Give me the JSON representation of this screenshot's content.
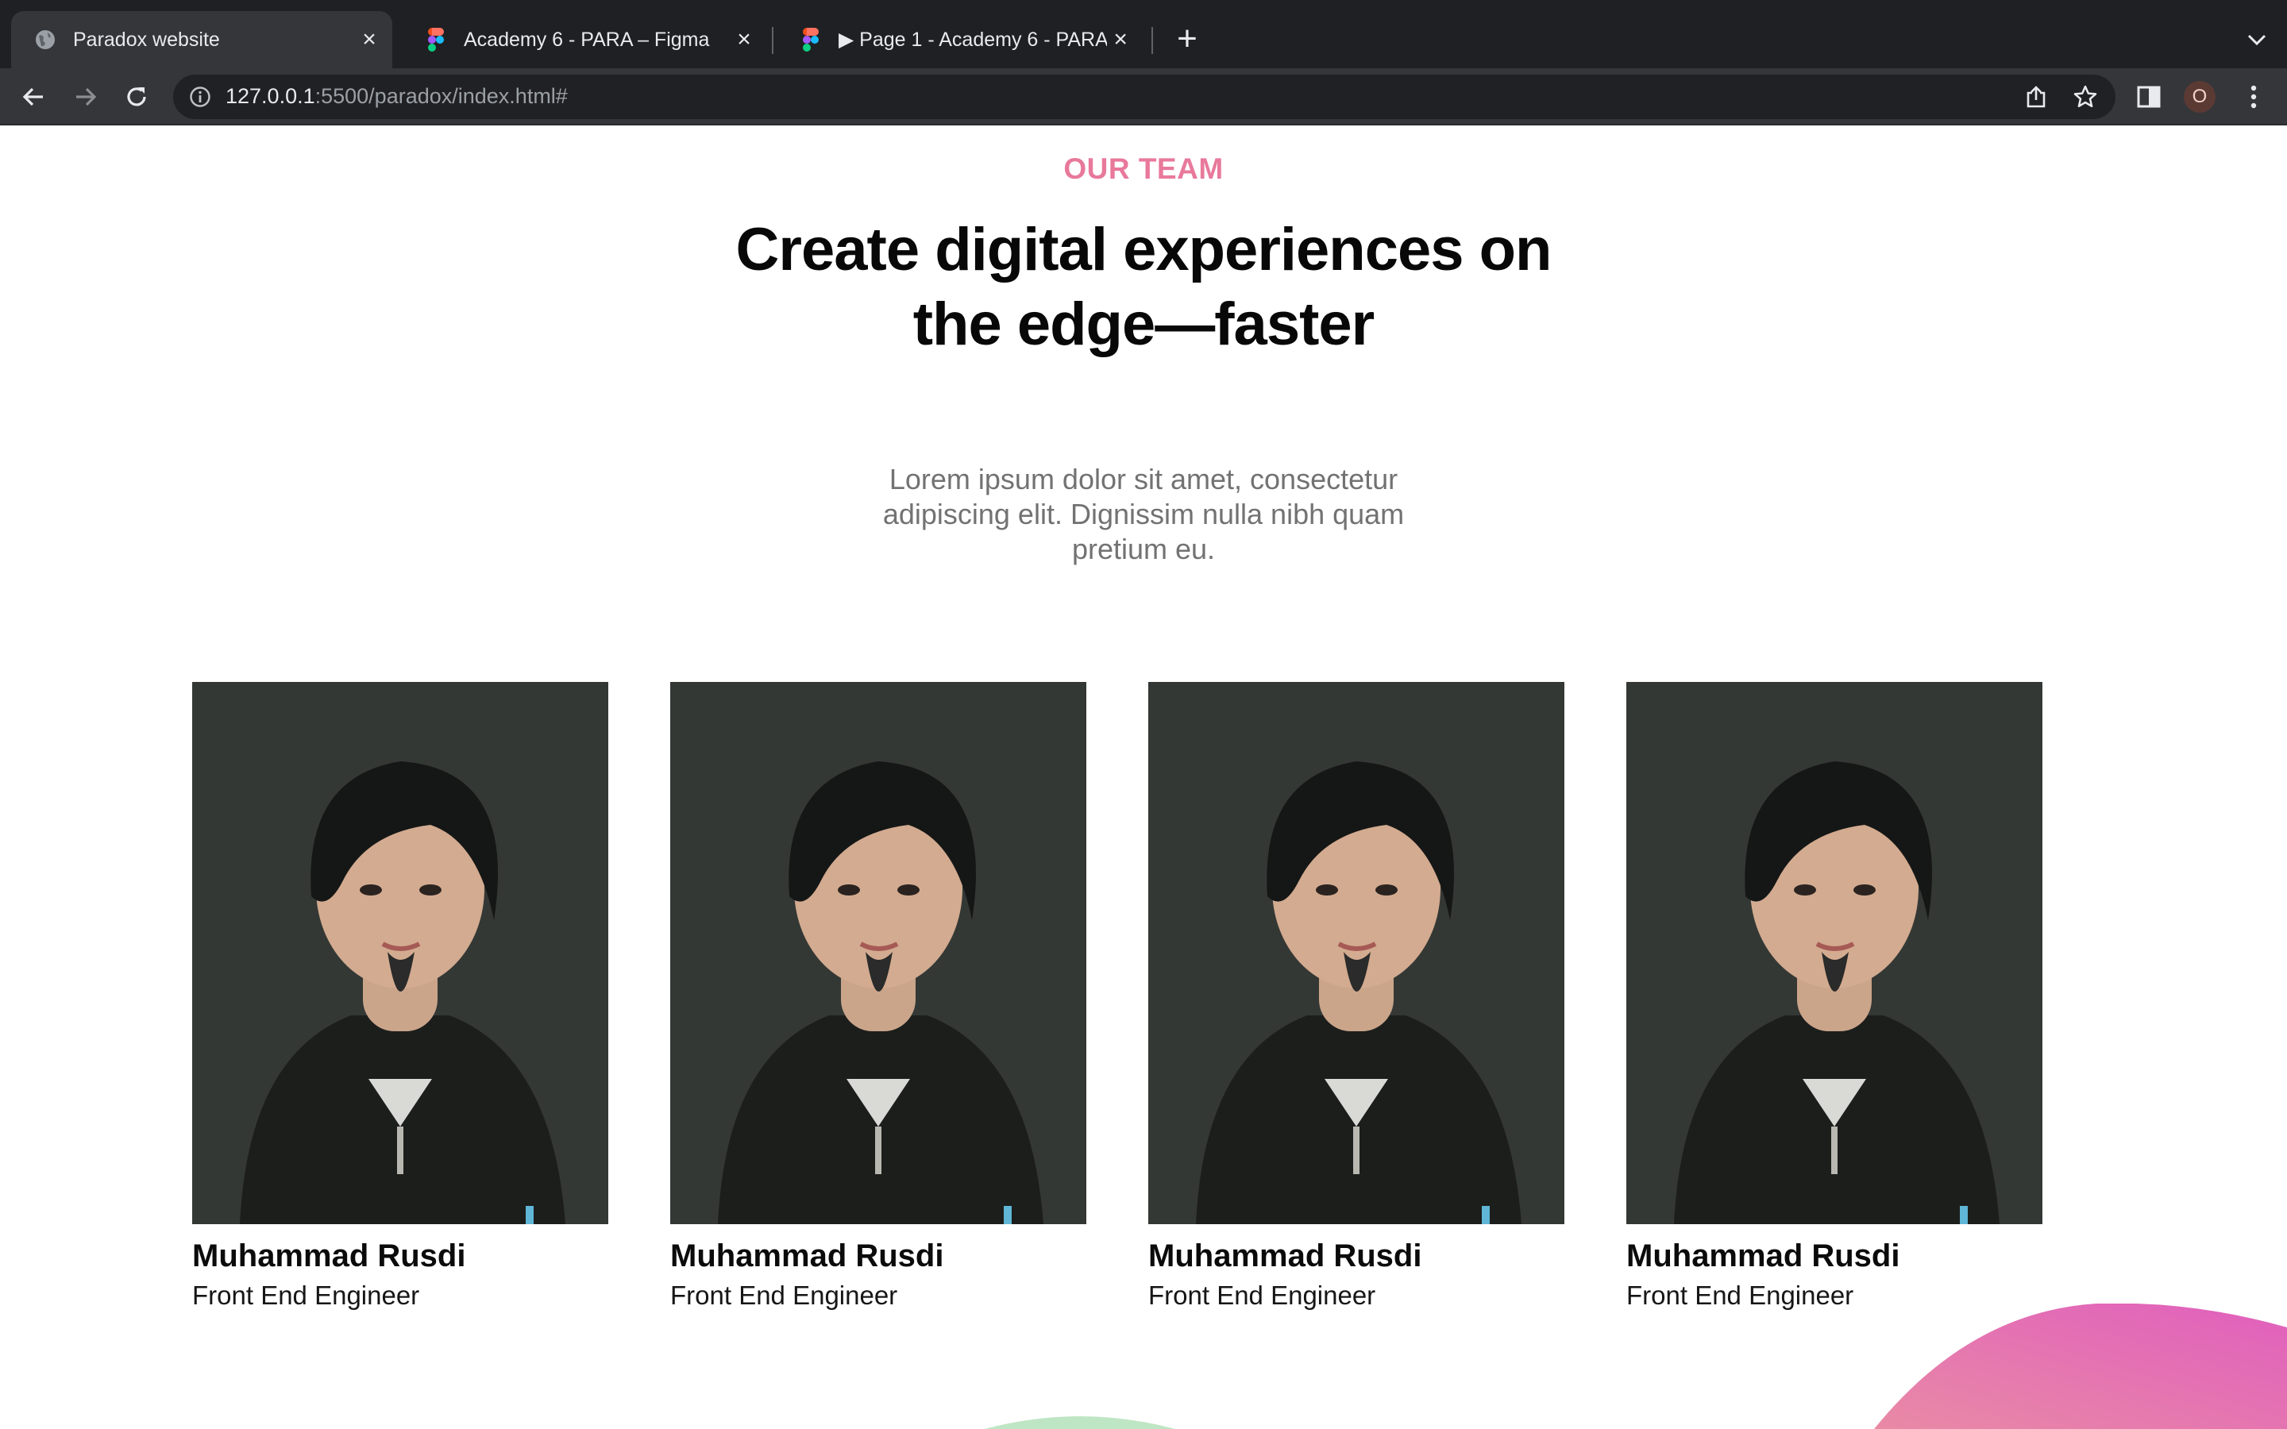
{
  "browser": {
    "tabs": [
      {
        "title": "Paradox website",
        "icon": "globe-icon",
        "active": true
      },
      {
        "title": "Academy 6 - PARA – Figma",
        "icon": "figma-icon",
        "active": false
      },
      {
        "title": "▶ Page 1 - Academy 6 - PARA",
        "icon": "figma-icon",
        "active": false
      }
    ],
    "new_tab": "+",
    "url_host": "127.0.0.1",
    "url_path": ":5500/paradox/index.html#",
    "profile_initial": "O"
  },
  "team_section": {
    "eyebrow": "OUR TEAM",
    "headline_line1": "Create digital experiences on",
    "headline_line2": "the edge—faster",
    "intro_line1": "Lorem ipsum dolor sit amet, consectetur",
    "intro_line2": "adipiscing elit. Dignissim nulla nibh quam",
    "intro_line3": "pretium eu.",
    "members": [
      {
        "name": "Muhammad Rusdi",
        "role": "Front End Engineer"
      },
      {
        "name": "Muhammad Rusdi",
        "role": "Front End Engineer"
      },
      {
        "name": "Muhammad Rusdi",
        "role": "Front End Engineer"
      },
      {
        "name": "Muhammad Rusdi",
        "role": "Front End Engineer"
      }
    ]
  },
  "colors": {
    "accent_pink": "#e8799b",
    "blob_gradient_start": "#e98aa5",
    "blob_gradient_end": "#e05fbd",
    "blob_green": "#bfe6c4",
    "photo_background": "#333734"
  }
}
